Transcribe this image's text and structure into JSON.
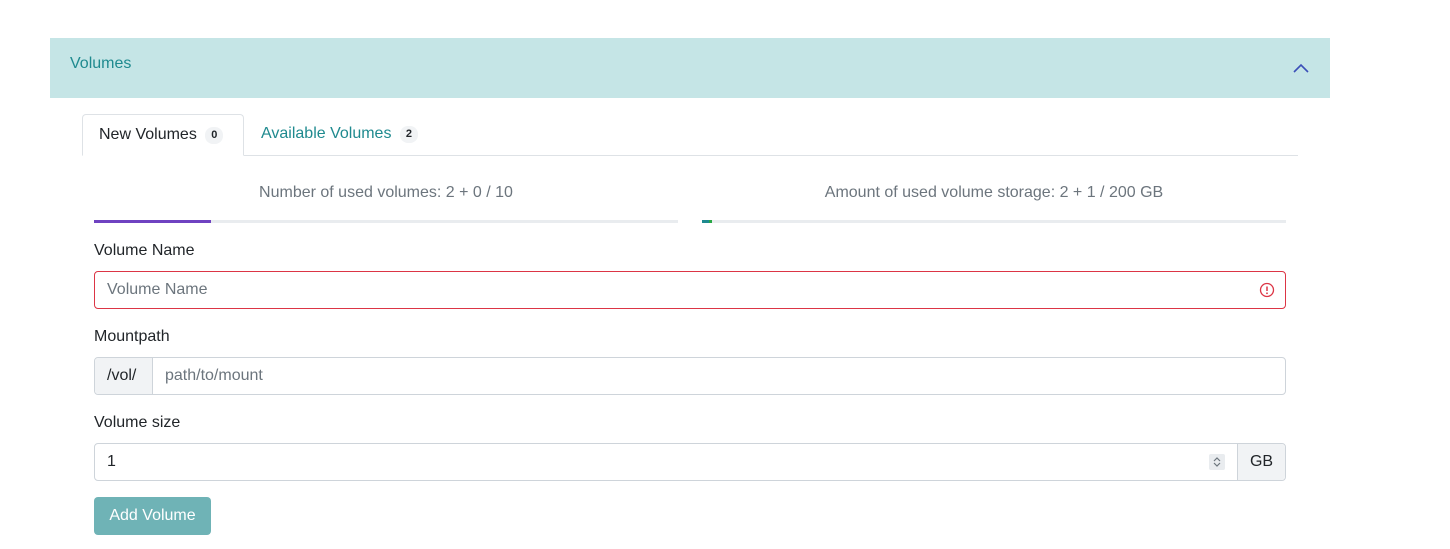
{
  "accordion": {
    "title": "Volumes"
  },
  "tabs": [
    {
      "label": "New Volumes",
      "count": "0",
      "active": true
    },
    {
      "label": "Available Volumes",
      "count": "2",
      "active": false
    }
  ],
  "usage": {
    "volumes_label": "Number of used volumes: 2 + 0 / 10",
    "volumes_used": 2,
    "volumes_new": 0,
    "volumes_max": 10,
    "storage_label": "Amount of used volume storage: 2 + 1 / 200 GB",
    "storage_used": 2,
    "storage_new": 1,
    "storage_max": 200
  },
  "form": {
    "volume_name": {
      "label": "Volume Name",
      "placeholder": "Volume Name",
      "value": ""
    },
    "mountpath": {
      "label": "Mountpath",
      "prefix": "/vol/",
      "placeholder": "path/to/mount",
      "value": ""
    },
    "volume_size": {
      "label": "Volume size",
      "value": "1",
      "unit": "GB"
    },
    "submit_label": "Add Volume"
  },
  "colors": {
    "accent": "#1f8a8f",
    "header_bg": "#c5e5e6",
    "bar_used": "#6f42c1",
    "bar_new": "#28a745",
    "storage_bar": "#1f8a8f",
    "error": "#dc3545",
    "button_bg": "#6fb3b6"
  }
}
